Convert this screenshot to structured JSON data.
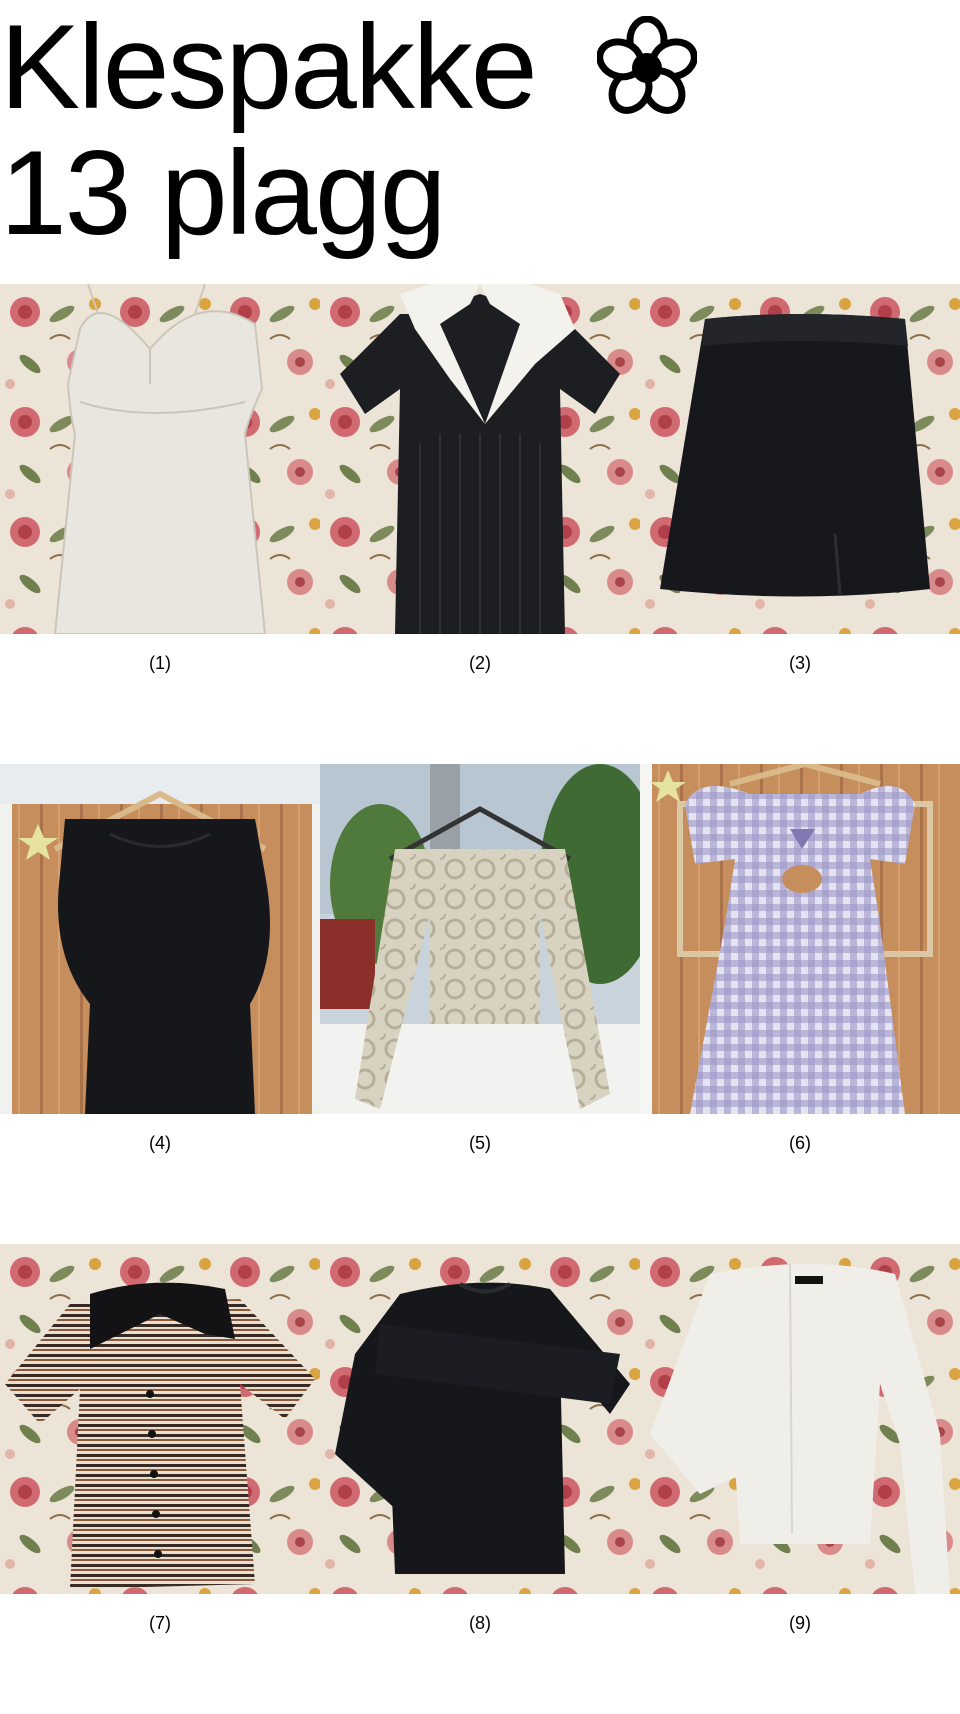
{
  "header": {
    "title_line1": "Klespakke",
    "title_line2": "13 plagg",
    "flower_icon": "flower-icon"
  },
  "items": [
    {
      "caption": "(1)"
    },
    {
      "caption": "(2)"
    },
    {
      "caption": "(3)"
    },
    {
      "caption": "(4)"
    },
    {
      "caption": "(5)"
    },
    {
      "caption": "(6)"
    },
    {
      "caption": "(7)"
    },
    {
      "caption": "(8)"
    },
    {
      "caption": "(9)"
    }
  ],
  "colors": {
    "background": "#ffffff",
    "text": "#000000",
    "floral_base": "#ece4d6",
    "floral_red": "#c9545b",
    "floral_green": "#7d8a5b",
    "wood": "#c58e5c"
  }
}
